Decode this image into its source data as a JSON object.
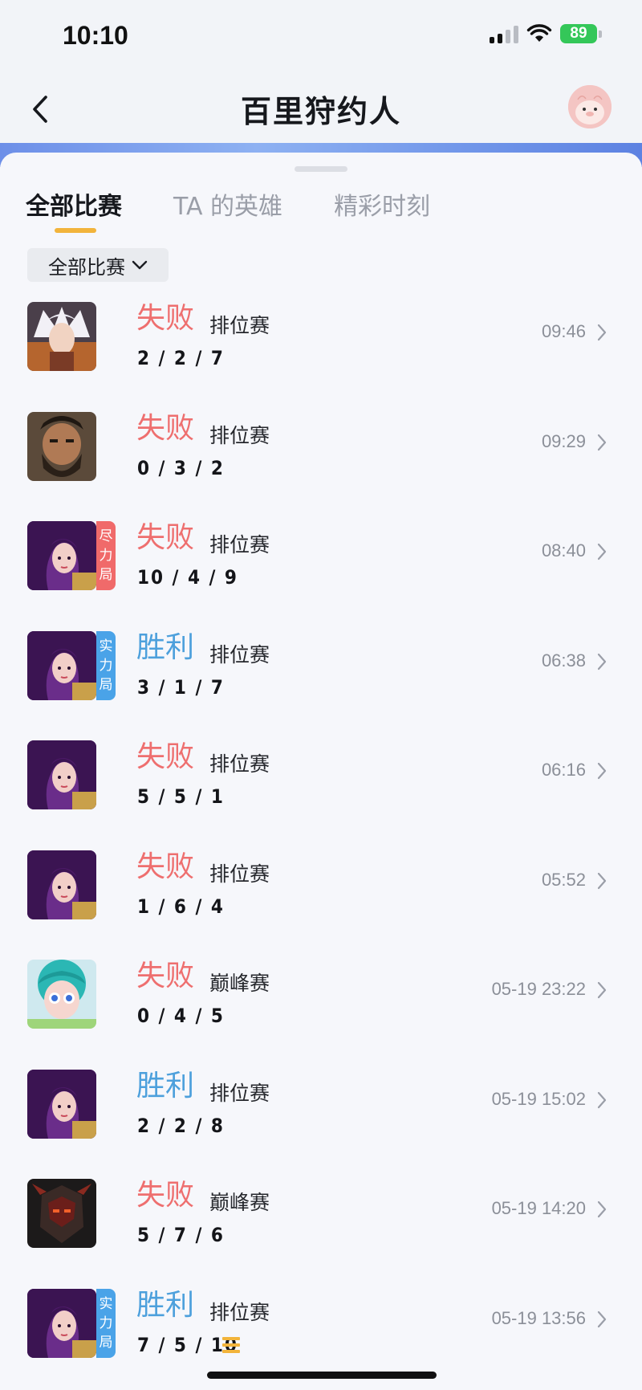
{
  "status": {
    "time": "10:10",
    "battery": "89"
  },
  "nav": {
    "title": "百里狩约人"
  },
  "tabs": [
    {
      "label": "全部比赛",
      "active": true
    },
    {
      "label": "TA 的英雄",
      "active": false
    },
    {
      "label": "精彩时刻",
      "active": false
    }
  ],
  "filter": {
    "label": "全部比赛"
  },
  "matches": [
    {
      "result": "失败",
      "outcome": "lose",
      "mode": "排位赛",
      "kda": "2 / 2 / 7",
      "time": "09:46",
      "tag": null,
      "hero_icon": "hero-white-hair"
    },
    {
      "result": "失败",
      "outcome": "lose",
      "mode": "排位赛",
      "kda": "0 / 3 / 2",
      "time": "09:29",
      "tag": null,
      "hero_icon": "hero-bearded-warrior"
    },
    {
      "result": "失败",
      "outcome": "lose",
      "mode": "排位赛",
      "kda": "10 / 4 / 9",
      "time": "08:40",
      "tag": {
        "text": [
          "尽",
          "力",
          "局"
        ],
        "color": "red"
      },
      "hero_icon": "hero-purple-hair"
    },
    {
      "result": "胜利",
      "outcome": "win",
      "mode": "排位赛",
      "kda": "3 / 1 / 7",
      "time": "06:38",
      "tag": {
        "text": [
          "实",
          "力",
          "局"
        ],
        "color": "blue"
      },
      "hero_icon": "hero-purple-hair"
    },
    {
      "result": "失败",
      "outcome": "lose",
      "mode": "排位赛",
      "kda": "5 / 5 / 1",
      "time": "06:16",
      "tag": null,
      "hero_icon": "hero-purple-hair"
    },
    {
      "result": "失败",
      "outcome": "lose",
      "mode": "排位赛",
      "kda": "1 / 6 / 4",
      "time": "05:52",
      "tag": null,
      "hero_icon": "hero-purple-hair"
    },
    {
      "result": "失败",
      "outcome": "lose",
      "mode": "巅峰赛",
      "kda": "0 / 4 / 5",
      "time": "05-19 23:22",
      "tag": null,
      "hero_icon": "hero-teal-hair"
    },
    {
      "result": "胜利",
      "outcome": "win",
      "mode": "排位赛",
      "kda": "2 / 2 / 8",
      "time": "05-19 15:02",
      "tag": null,
      "hero_icon": "hero-purple-hair"
    },
    {
      "result": "失败",
      "outcome": "lose",
      "mode": "巅峰赛",
      "kda": "5 / 7 / 6",
      "time": "05-19 14:20",
      "tag": null,
      "hero_icon": "hero-dark-armor"
    },
    {
      "result": "胜利",
      "outcome": "win",
      "mode": "排位赛",
      "kda": "7 / 5 / 10",
      "time": "05-19 13:56",
      "tag": {
        "text": [
          "实",
          "力",
          "局"
        ],
        "color": "blue"
      },
      "hero_icon": "hero-purple-hair",
      "mvp": true
    }
  ],
  "colors": {
    "lose": "#ee6f6f",
    "win": "#4da0dc",
    "accent": "#f2b43b"
  }
}
